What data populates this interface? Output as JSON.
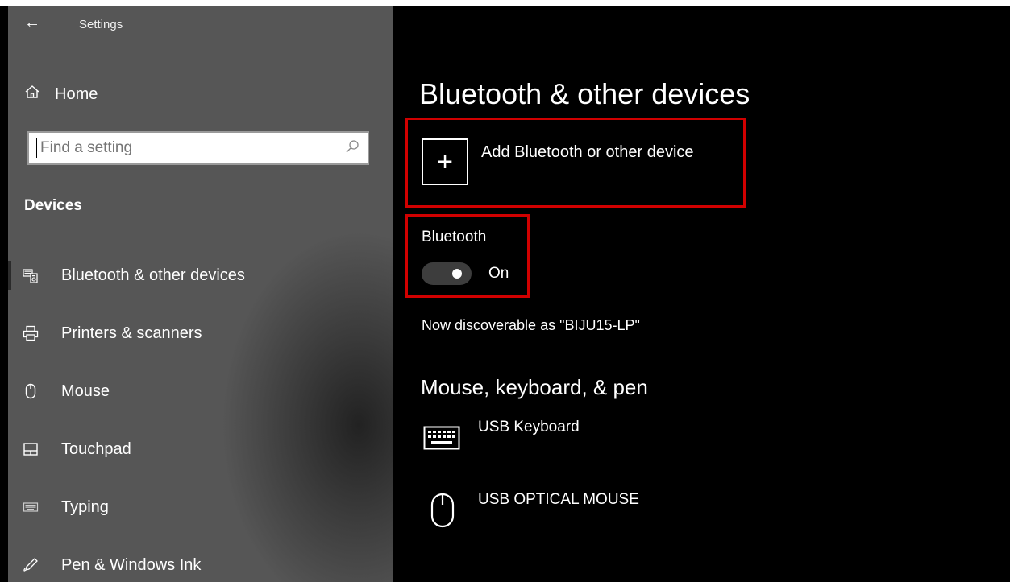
{
  "window": {
    "title": "Settings"
  },
  "sidebar": {
    "home_label": "Home",
    "search": {
      "placeholder": "Find a setting"
    },
    "section_label": "Devices",
    "items": [
      {
        "label": "Bluetooth & other devices",
        "icon": "bluetooth-devices-icon",
        "selected": true
      },
      {
        "label": "Printers & scanners",
        "icon": "printer-icon"
      },
      {
        "label": "Mouse",
        "icon": "mouse-icon"
      },
      {
        "label": "Touchpad",
        "icon": "touchpad-icon"
      },
      {
        "label": "Typing",
        "icon": "keyboard-icon"
      },
      {
        "label": "Pen & Windows Ink",
        "icon": "pen-icon"
      }
    ]
  },
  "main": {
    "title": "Bluetooth & other devices",
    "add_device_label": "Add Bluetooth or other device",
    "bluetooth": {
      "label": "Bluetooth",
      "state": "On",
      "enabled": true
    },
    "discoverable_text": "Now discoverable as \"BIJU15-LP\"",
    "section_heading": "Mouse, keyboard, & pen",
    "devices": [
      {
        "name": "USB Keyboard",
        "icon": "keyboard-icon"
      },
      {
        "name": "USB OPTICAL MOUSE",
        "icon": "mouse-icon"
      }
    ]
  },
  "colors": {
    "sidebar_bg": "#565656",
    "main_bg": "#000000",
    "highlight": "#d00000"
  }
}
